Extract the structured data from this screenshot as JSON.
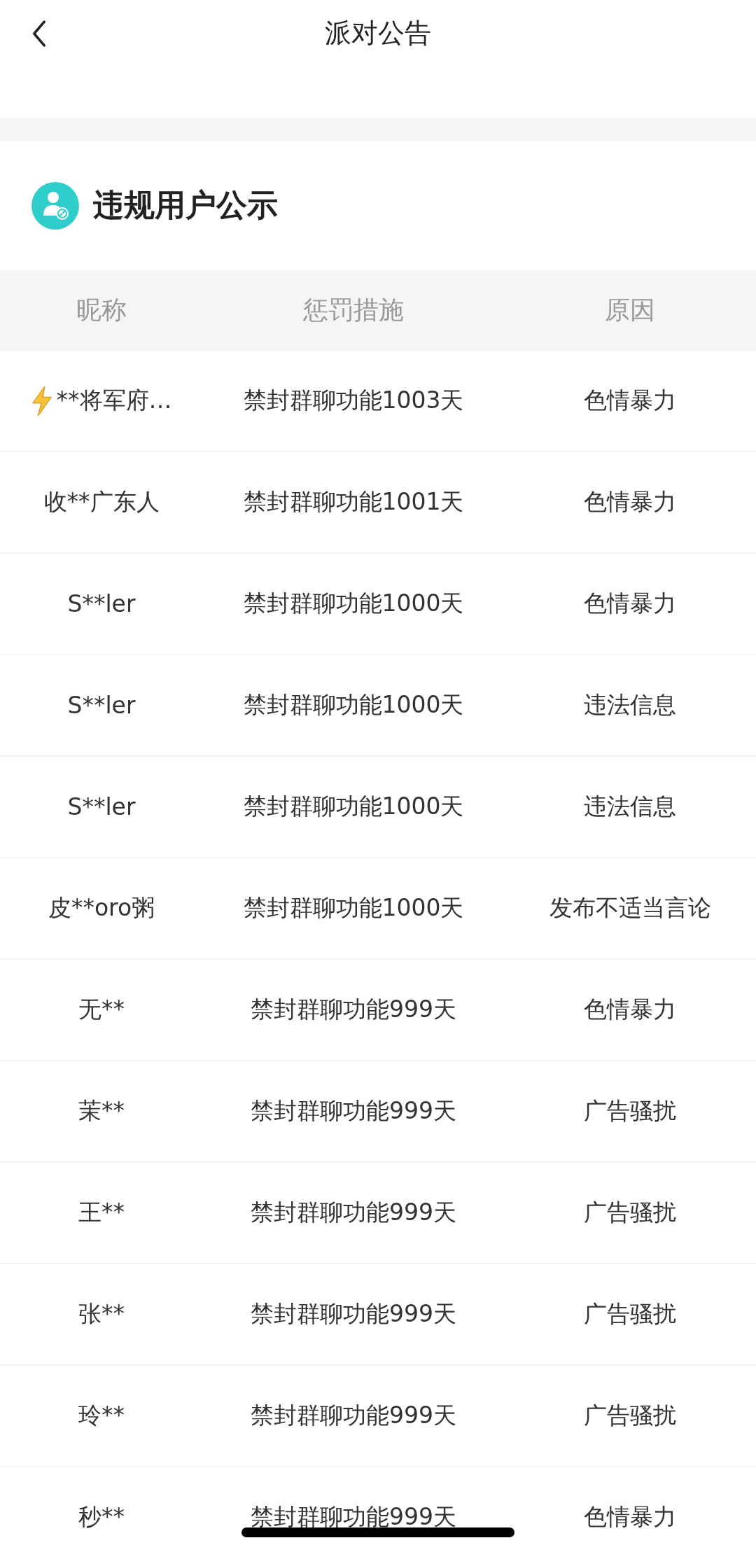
{
  "nav": {
    "title": "派对公告"
  },
  "section": {
    "title": "违规用户公示"
  },
  "table": {
    "columns": [
      "昵称",
      "惩罚措施",
      "原因"
    ],
    "rows": [
      {
        "nickname": "**将军府…",
        "kind": "lightning",
        "penalty": "禁封群聊功能1003天",
        "reason": "色情暴力"
      },
      {
        "nickname": "收**广东人",
        "penalty": "禁封群聊功能1001天",
        "reason": "色情暴力"
      },
      {
        "nickname": "S**ler",
        "penalty": "禁封群聊功能1000天",
        "reason": "色情暴力"
      },
      {
        "nickname": "S**ler",
        "penalty": "禁封群聊功能1000天",
        "reason": "违法信息"
      },
      {
        "nickname": "S**ler",
        "penalty": "禁封群聊功能1000天",
        "reason": "违法信息"
      },
      {
        "nickname": "皮**oro粥",
        "penalty": "禁封群聊功能1000天",
        "reason": "发布不适当言论"
      },
      {
        "nickname": "无**",
        "penalty": "禁封群聊功能999天",
        "reason": "色情暴力"
      },
      {
        "nickname": "茉**",
        "penalty": "禁封群聊功能999天",
        "reason": "广告骚扰"
      },
      {
        "nickname": "王**",
        "penalty": "禁封群聊功能999天",
        "reason": "广告骚扰"
      },
      {
        "nickname": "张**",
        "penalty": "禁封群聊功能999天",
        "reason": "广告骚扰"
      },
      {
        "nickname": "玲**",
        "penalty": "禁封群聊功能999天",
        "reason": "广告骚扰"
      },
      {
        "nickname": "秒**",
        "penalty": "禁封群聊功能999天",
        "reason": "色情暴力"
      }
    ]
  }
}
